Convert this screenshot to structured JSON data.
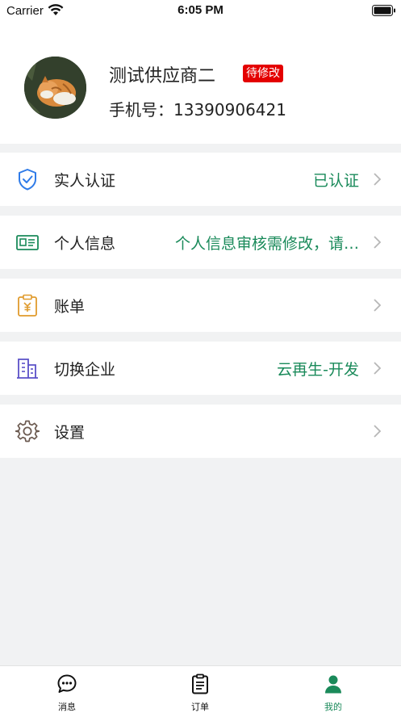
{
  "status_bar": {
    "carrier": "Carrier",
    "time": "6:05 PM"
  },
  "profile": {
    "name": "测试供应商二",
    "status": "待修改",
    "phone_label": "手机号：",
    "phone": "13390906421"
  },
  "menu": [
    {
      "icon": "shield-check-icon",
      "label": "实人认证",
      "value": "已认证"
    },
    {
      "icon": "id-card-icon",
      "label": "个人信息",
      "value": "个人信息审核需修改，请…"
    },
    {
      "icon": "bill-icon",
      "label": "账单",
      "value": ""
    },
    {
      "icon": "building-icon",
      "label": "切换企业",
      "value": "云再生-开发"
    },
    {
      "icon": "gear-icon",
      "label": "设置",
      "value": ""
    }
  ],
  "tabs": [
    {
      "icon": "chat-bubble-icon",
      "label": "消息",
      "active": false
    },
    {
      "icon": "clipboard-icon",
      "label": "订单",
      "active": false
    },
    {
      "icon": "person-icon",
      "label": "我的",
      "active": true
    }
  ],
  "colors": {
    "accent": "#1a8a5a",
    "badge": "#e40000",
    "background": "#f1f2f3"
  }
}
